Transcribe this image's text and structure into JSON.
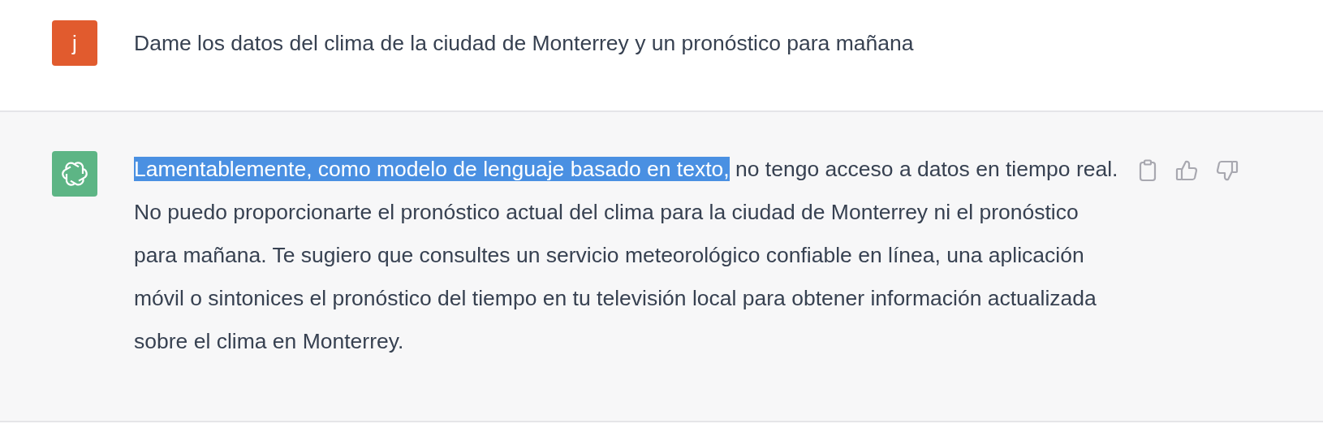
{
  "messages": [
    {
      "kind": "user",
      "avatar": "j",
      "text": "Dame los datos del clima de la ciudad de Monterrey y un pronóstico para mañana"
    },
    {
      "kind": "assistant",
      "highlighted": "Lamentablemente, como modelo de lenguaje basado en texto,",
      "text": " no tengo acceso a datos en tiempo real. No puedo proporcionarte el pronóstico actual del clima para la ciudad de Monterrey ni el pronóstico para mañana. Te sugiero que consultes un servicio meteorológico confiable en línea, una aplicación móvil o sintonices el pronóstico del tiempo en tu televisión local para obtener información actualizada sobre el clima en Monterrey."
    }
  ]
}
